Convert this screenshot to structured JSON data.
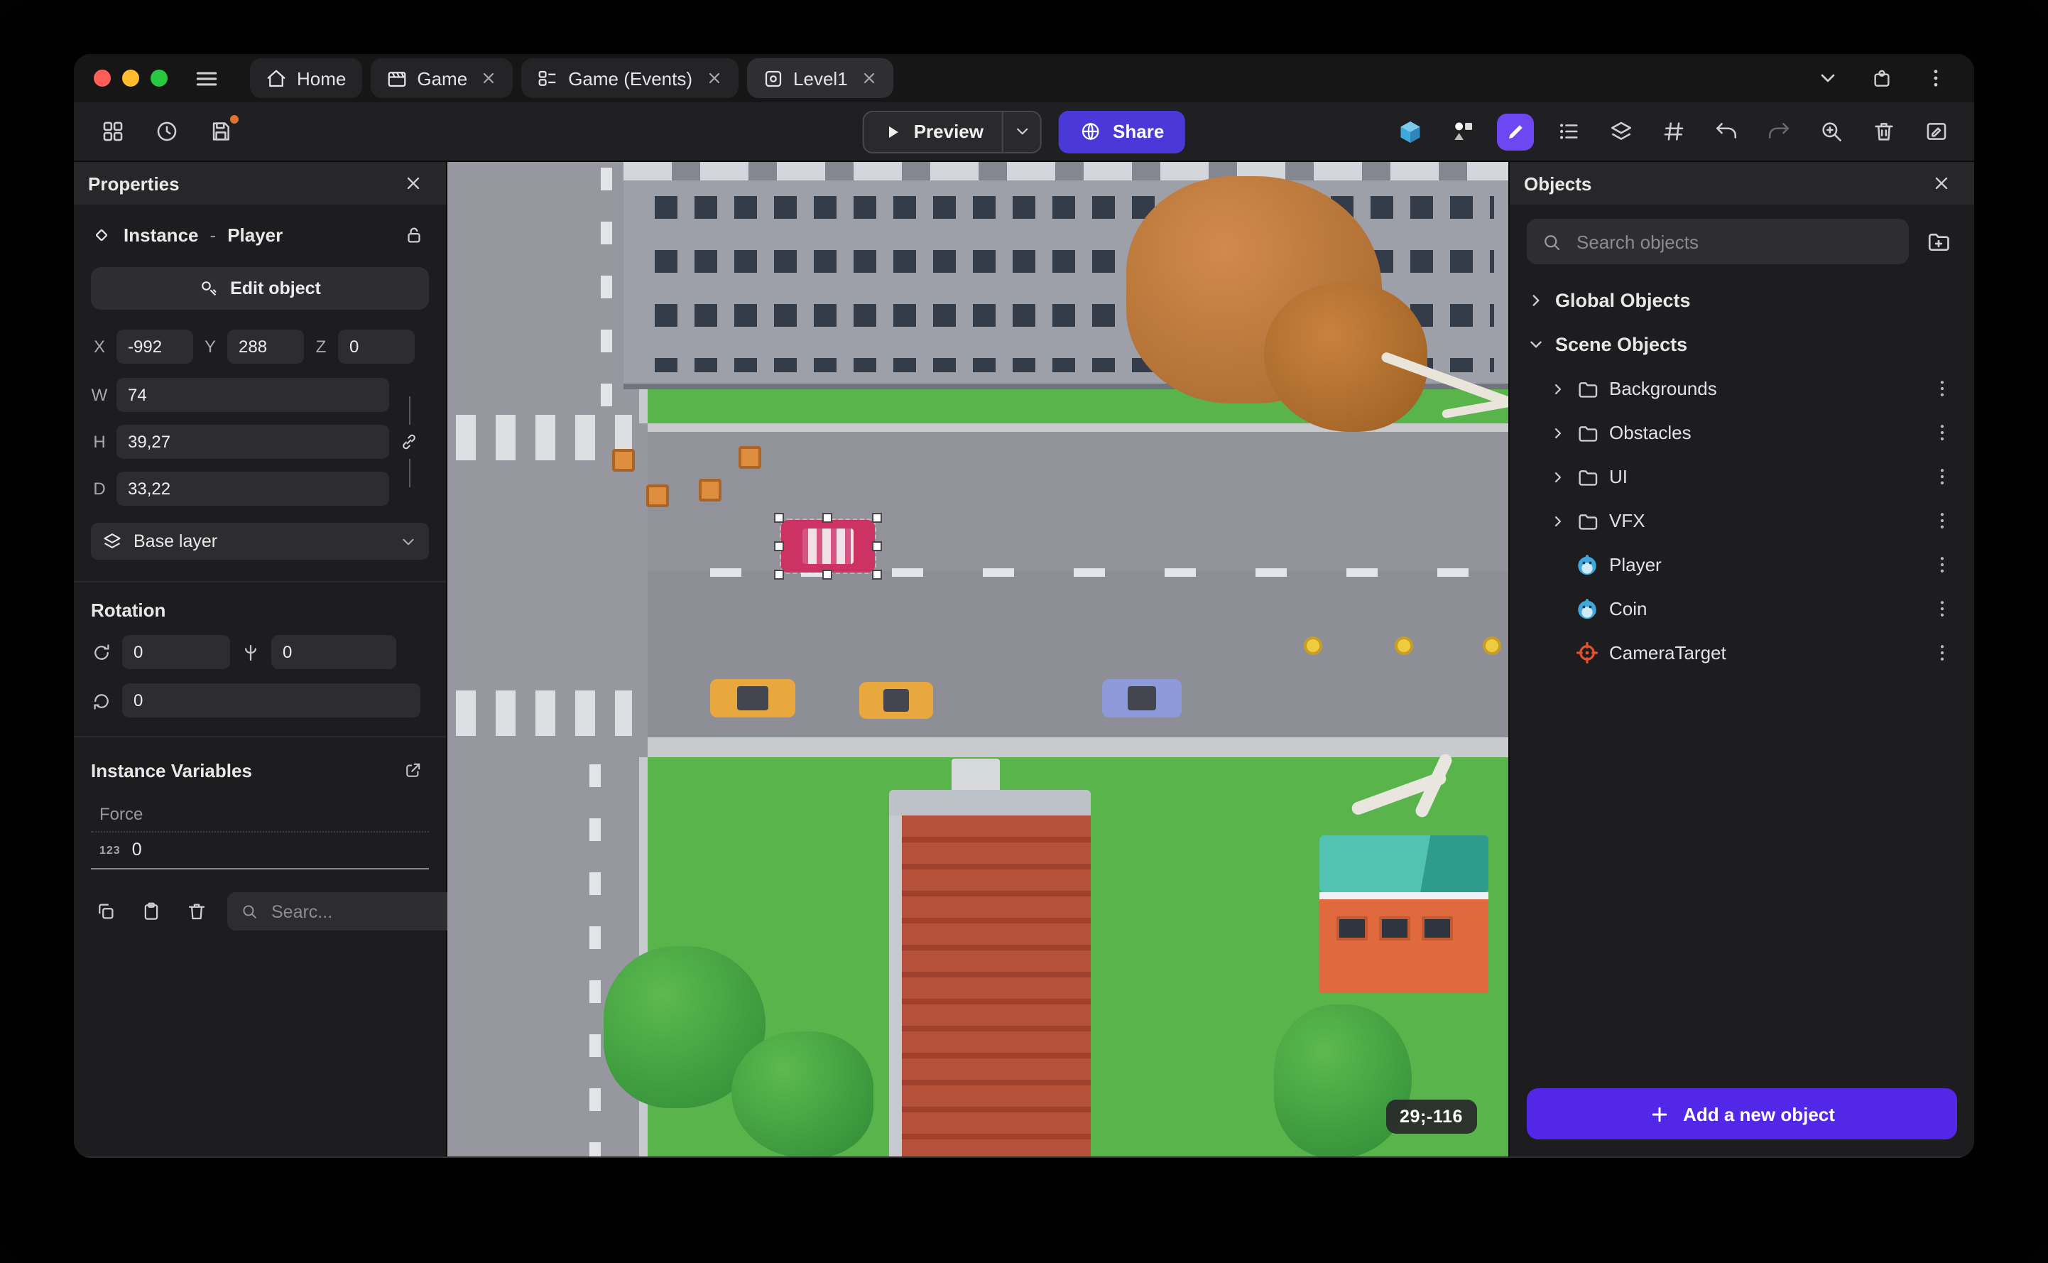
{
  "colors": {
    "accent_purple": "#5327E8",
    "share_indigo": "#4A39D8",
    "active_tool_purple": "#6C47F2",
    "grass_green": "#58B44B",
    "road_gray": "#8E8E97",
    "brick_red": "#B5513B",
    "selection_handle": "#FFFFFF",
    "traffic_red": "#FF5F57",
    "traffic_yellow": "#FEBC2E",
    "traffic_green": "#28C840"
  },
  "titlebar": {
    "tabs": [
      {
        "label": "Home"
      },
      {
        "label": "Game"
      },
      {
        "label": "Game (Events)"
      },
      {
        "label": "Level1"
      }
    ]
  },
  "toolbar": {
    "preview": "Preview",
    "share": "Share"
  },
  "properties": {
    "title": "Properties",
    "instance_type": "Instance",
    "dash": "-",
    "object_name": "Player",
    "edit_object": "Edit object",
    "x_label": "X",
    "y_label": "Y",
    "z_label": "Z",
    "x": "-992",
    "y": "288",
    "z": "0",
    "w_label": "W",
    "h_label": "H",
    "d_label": "D",
    "w": "74",
    "h": "39,27",
    "d": "33,22",
    "layer": "Base layer",
    "rotation_title": "Rotation",
    "rot_x": "0",
    "rot_y": "0",
    "rot_z": "0",
    "variables_title": "Instance Variables",
    "var_name": "Force",
    "var_type": "123",
    "var_value": "0",
    "var_search_placeholder": "Searc..."
  },
  "canvas": {
    "coords_badge": "29;-116"
  },
  "objects": {
    "title": "Objects",
    "search_placeholder": "Search objects",
    "global_group": "Global Objects",
    "scene_group": "Scene Objects",
    "folders": [
      "Backgrounds",
      "Obstacles",
      "UI",
      "VFX"
    ],
    "items": [
      "Player",
      "Coin",
      "CameraTarget"
    ],
    "add_button": "Add a new object"
  }
}
